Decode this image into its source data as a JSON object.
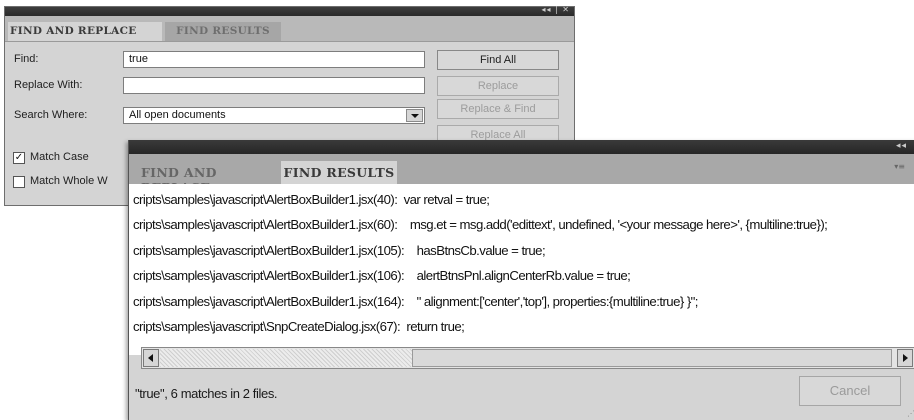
{
  "find_replace_panel": {
    "tabs": [
      "FIND AND REPLACE",
      "FIND RESULTS"
    ],
    "window_controls": "◂◂ | ✕",
    "find_label": "Find:",
    "find_value": "true",
    "replace_label": "Replace With:",
    "replace_value": "",
    "search_where_label": "Search Where:",
    "search_where_value": "All open documents",
    "match_case_label": "Match Case",
    "match_case_checked": true,
    "match_whole_label": "Match Whole W",
    "match_whole_checked": false,
    "buttons": {
      "find_all": "Find All",
      "replace": "Replace",
      "replace_and_find": "Replace & Find",
      "replace_all": "Replace All"
    }
  },
  "find_results_panel": {
    "tabs": [
      "FIND AND REPLACE",
      "FIND RESULTS"
    ],
    "window_controls": "◂◂",
    "panel_menu": "▾≡",
    "results": [
      "cripts\\samples\\javascript\\AlertBoxBuilder1.jsx(40):  var retval = true;",
      "cripts\\samples\\javascript\\AlertBoxBuilder1.jsx(60):    msg.et = msg.add('edittext', undefined, '<your message here>', {multiline:true});",
      "cripts\\samples\\javascript\\AlertBoxBuilder1.jsx(105):    hasBtnsCb.value = true;",
      "cripts\\samples\\javascript\\AlertBoxBuilder1.jsx(106):    alertBtnsPnl.alignCenterRb.value = true;",
      "cripts\\samples\\javascript\\AlertBoxBuilder1.jsx(164):    \" alignment:['center','top'], properties:{multiline:true} }\";",
      "cripts\\samples\\javascript\\SnpCreateDialog.jsx(67):  return true;"
    ],
    "status": "\"true\", 6 matches in 2 files.",
    "cancel_label": "Cancel"
  },
  "colors": {
    "panel_bg": "#d4d4d4",
    "titlebar": "#2a2a2a",
    "disabled_text": "#9c9c9c"
  }
}
